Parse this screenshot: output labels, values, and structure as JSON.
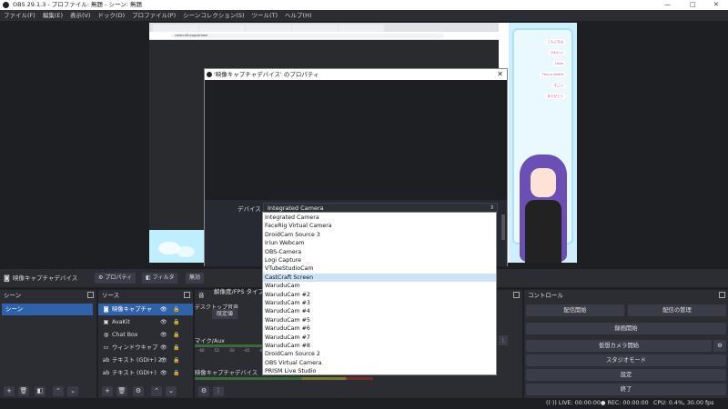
{
  "window": {
    "title": "OBS 29.1.3 - プロファイル: 無題 - シーン: 無題",
    "minimize": "—",
    "maximize": "□",
    "close": "✕"
  },
  "menu": [
    "ファイル(F)",
    "編集(E)",
    "表示(V)",
    "ドック(D)",
    "プロファイル(P)",
    "シーンコレクション(S)",
    "ツール(T)",
    "ヘルプ(H)"
  ],
  "browser": {
    "url": "castcraft.app/stream"
  },
  "vtuber_chat": [
    "こんにちは",
    "かわいい",
    "Hello",
    "This is AvaKit",
    "すごい",
    "ありがとう"
  ],
  "dialog": {
    "title": "'映像キャプチャデバイス' のプロパティ",
    "close": "✕",
    "device_label": "デバイス",
    "device_value": "Integrated Camera",
    "resolution_label": "解像度/FPS タイプ",
    "default_button": "既定値"
  },
  "dropdown": {
    "items": [
      "Integrated Camera",
      "FaceRig Virtual Camera",
      "DroidCam Source 3",
      "Iriun Webcam",
      "OBS-Camera",
      "Logi Capture",
      "VTubeStudioCam",
      "CastCraft Screen",
      "WaruduCam",
      "WaruduCam #2",
      "WaruduCam #3",
      "WaruduCam #4",
      "WaruduCam #5",
      "WaruduCam #6",
      "WaruduCam #7",
      "WaruduCam #8",
      "DroidCam Source 2",
      "OBS Virtual Camera",
      "PRISM Live Studio"
    ],
    "selected_index": 7
  },
  "sourcebar": {
    "current": "映像キャプチャデバイス",
    "properties": "プロパティ",
    "filters": "フィルタ",
    "deactivate": "無効"
  },
  "scenes": {
    "title": "シーン",
    "items": [
      "シーン"
    ]
  },
  "sources": {
    "title": "ソース",
    "items": [
      {
        "icon": "camera-icon",
        "label": "映像キャプチャ"
      },
      {
        "icon": "image-icon",
        "label": "AvaKit"
      },
      {
        "icon": "globe-icon",
        "label": "Chat Box"
      },
      {
        "icon": "window-icon",
        "label": "ウィンドウキャプ"
      },
      {
        "icon": "text-icon",
        "label": "テキスト (GDI+) 2"
      },
      {
        "icon": "text-icon",
        "label": "テキスト (GDI+)"
      }
    ]
  },
  "mixer": {
    "title": "音",
    "track1": "デスクトップ音声",
    "track2": "マイク/Aux",
    "track3": "映像キャプチャデバイス",
    "db_ticks": [
      "-60",
      "-55",
      "-50",
      "-45",
      "-40"
    ]
  },
  "controls": {
    "title": "コントロール",
    "start_stream": "配信開始",
    "manage_stream": "配信の管理",
    "start_recording": "録画開始",
    "virtual_camera": "仮想カメラ開始",
    "studio_mode": "スタジオモード",
    "settings": "設定",
    "exit": "終了"
  },
  "status": {
    "live": "LIVE: 00:00:00",
    "rec": "REC: 00:00:00",
    "cpu": "CPU: 0.4%, 30.00 fps"
  }
}
